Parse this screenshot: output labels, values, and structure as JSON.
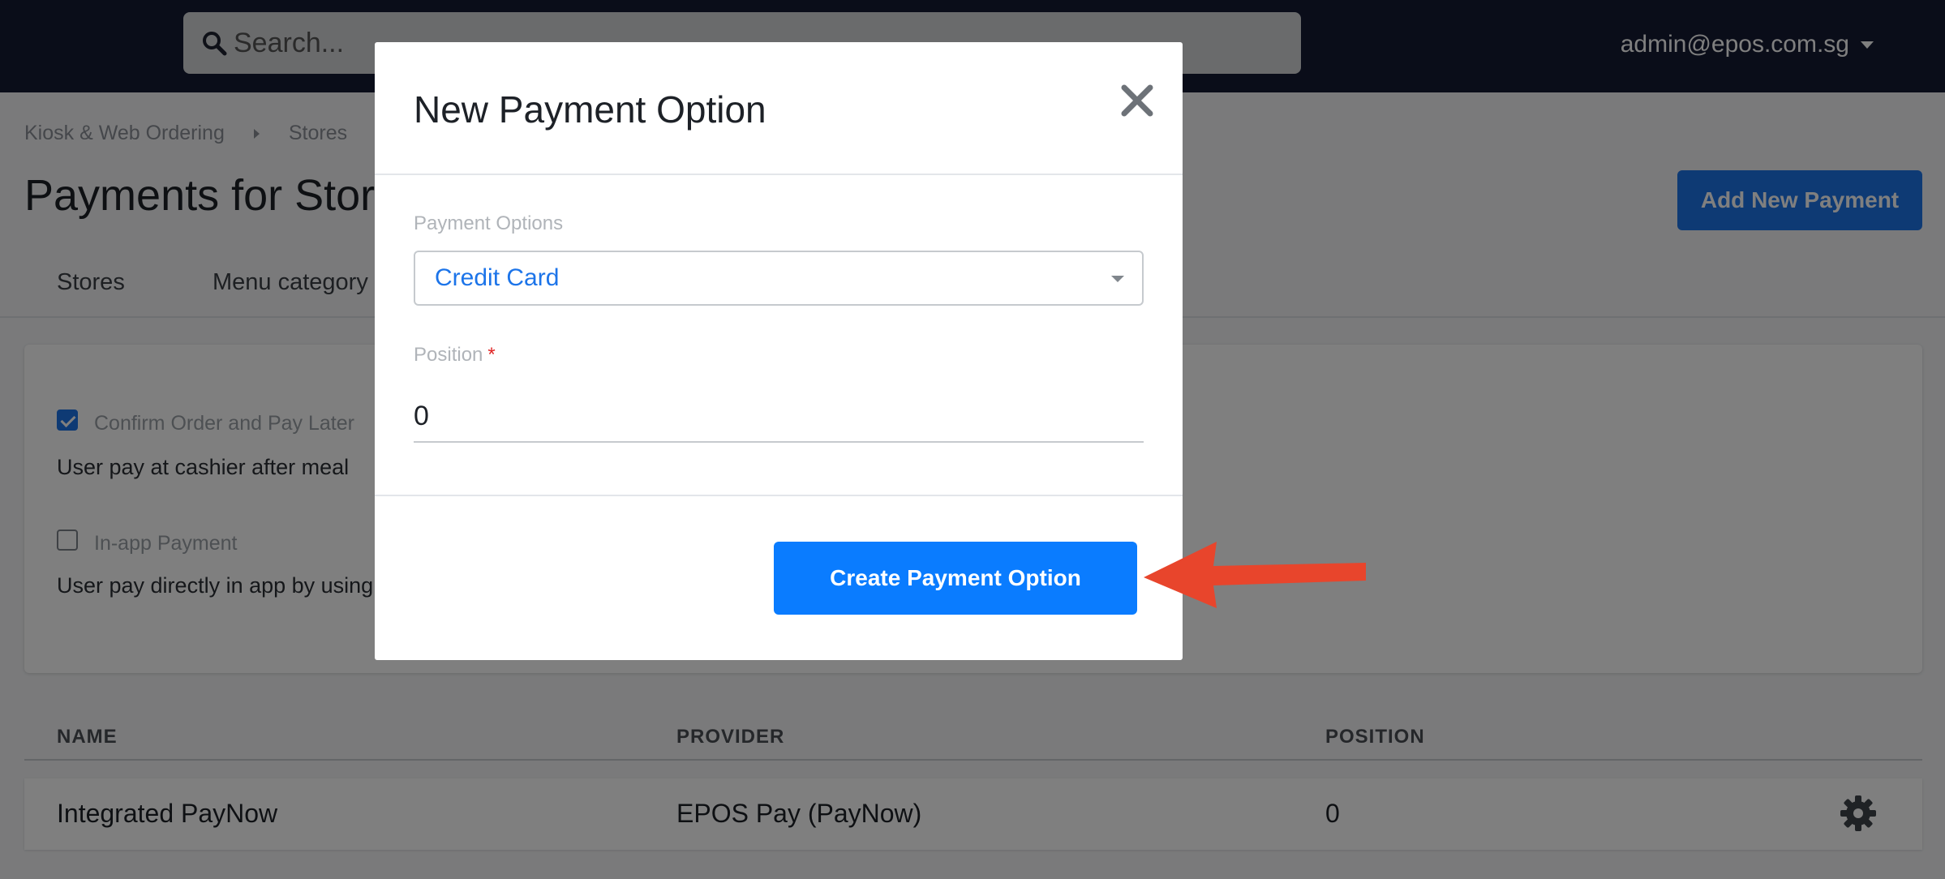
{
  "topbar": {
    "search_placeholder": "Search...",
    "user_email": "admin@epos.com.sg"
  },
  "breadcrumb": [
    "Kiosk & Web Ordering",
    "Stores"
  ],
  "page": {
    "title": "Payments for Store:",
    "add_button": "Add New Payment"
  },
  "tabs": [
    "Stores",
    "Menu category"
  ],
  "payment_settings": [
    {
      "label": "Confirm Order and Pay Later",
      "checked": true,
      "description": "User pay at cashier after meal"
    },
    {
      "label": "In-app Payment",
      "checked": false,
      "description": "User pay directly in app by using"
    }
  ],
  "table": {
    "headers": [
      "NAME",
      "PROVIDER",
      "POSITION"
    ],
    "rows": [
      {
        "name": "Integrated PayNow",
        "provider": "EPOS Pay (PayNow)",
        "position": "0"
      }
    ]
  },
  "modal": {
    "title": "New Payment Option",
    "payment_options_label": "Payment Options",
    "payment_options_value": "Credit Card",
    "position_label": "Position",
    "position_required": "*",
    "position_value": "0",
    "submit_button": "Create Payment Option"
  },
  "colors": {
    "navbar": "#151a33",
    "primary": "#0a7cff",
    "arrow": "#e8452c"
  }
}
